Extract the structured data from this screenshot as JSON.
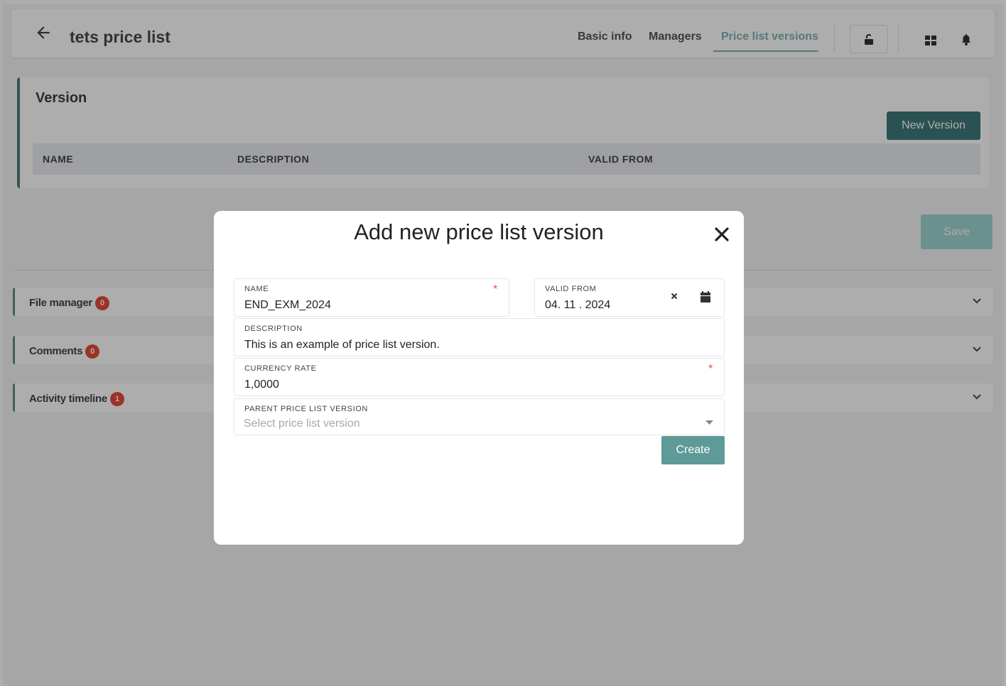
{
  "header": {
    "title": "tets price list",
    "tabs": [
      {
        "label": "Basic info",
        "active": false
      },
      {
        "label": "Managers",
        "active": false
      },
      {
        "label": "Price list versions",
        "active": true
      }
    ],
    "icons": [
      "arrow-left-icon",
      "unlock-icon",
      "apps-grid-icon",
      "bell-icon"
    ]
  },
  "version_section": {
    "title": "Version",
    "new_version_label": "New Version",
    "columns": [
      "NAME",
      "DESCRIPTION",
      "VALID FROM"
    ],
    "rows": []
  },
  "save_label": "Save",
  "accordions": [
    {
      "label": "File manager",
      "count": "0"
    },
    {
      "label": "Comments",
      "count": "0"
    },
    {
      "label": "Activity timeline",
      "count": "1"
    }
  ],
  "modal": {
    "title": "Add new price list version",
    "fields": {
      "name": {
        "label": "NAME",
        "value": "END_EXM_2024",
        "required": true
      },
      "valid_from": {
        "label": "VALID FROM",
        "value": "04. 11 . 2024"
      },
      "description": {
        "label": "DESCRIPTION",
        "value": "This is an example of price list version."
      },
      "currency_rate": {
        "label": "CURRENCY RATE",
        "value": "1,0000",
        "required": true
      },
      "parent": {
        "label": "PARENT PRICE LIST VERSION",
        "placeholder": "Select price list version"
      }
    },
    "create_label": "Create"
  },
  "colors": {
    "accent": "#7bb4b2",
    "button": "#3f7a79",
    "badge": "#e74c3c",
    "required": "#e74c3c"
  }
}
